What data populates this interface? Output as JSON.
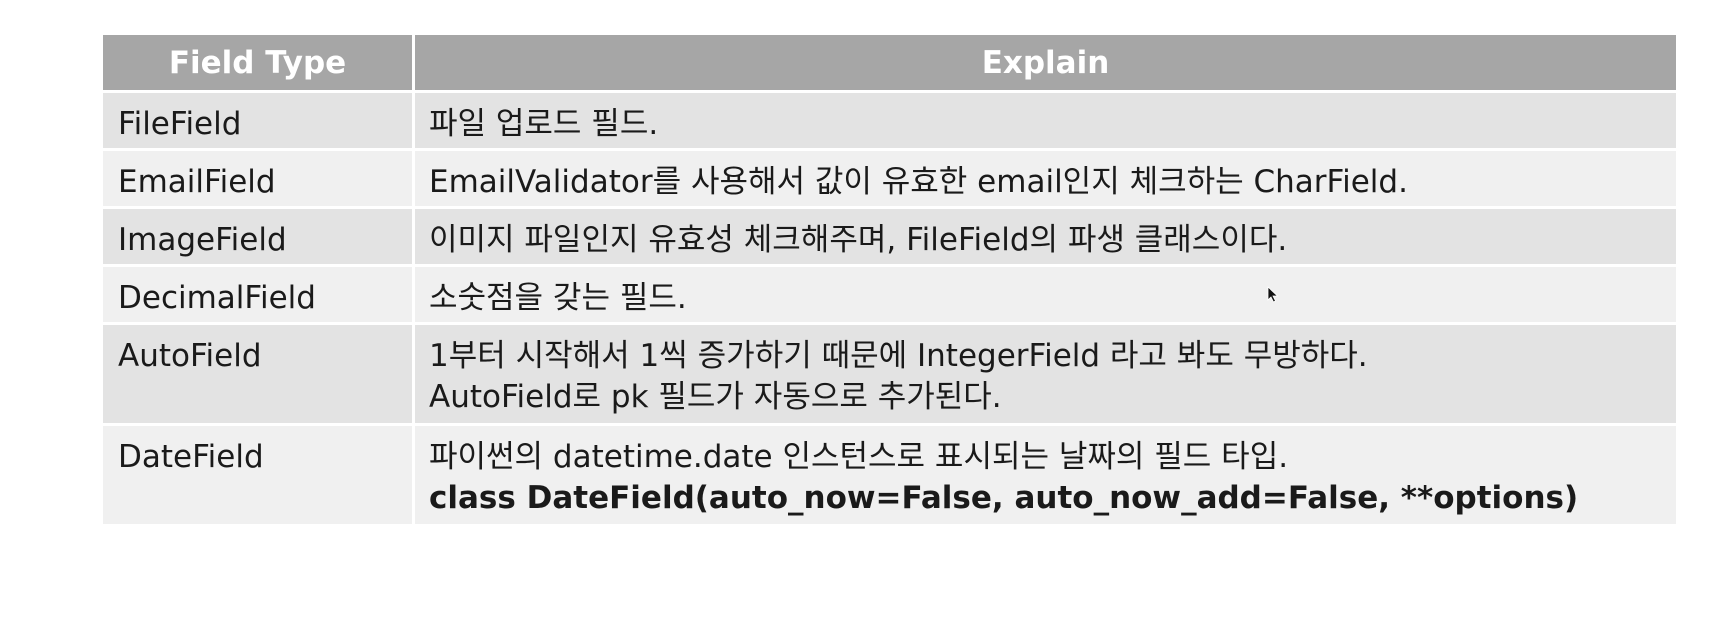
{
  "table": {
    "headers": [
      "Field Type",
      "Explain"
    ],
    "rows": [
      {
        "type": "FileField",
        "explain": [
          "파일 업로드 필드."
        ]
      },
      {
        "type": "EmailField",
        "explain": [
          "EmailValidator를 사용해서 값이 유효한 email인지 체크하는 CharField."
        ]
      },
      {
        "type": "ImageField",
        "explain": [
          "이미지 파일인지 유효성 체크해주며, FileField의 파생 클래스이다."
        ]
      },
      {
        "type": "DecimalField",
        "explain": [
          "소숫점을 갖는 필드."
        ]
      },
      {
        "type": "AutoField",
        "explain": [
          "1부터 시작해서 1씩 증가하기 때문에 IntegerField 라고 봐도 무방하다.",
          "AutoField로 pk 필드가 자동으로 추가된다."
        ]
      },
      {
        "type": "DateField",
        "explain": [
          "파이썬의 datetime.date 인스턴스로 표시되는 날짜의 필드 타입.",
          "class DateField(auto_now=False, auto_now_add=False, **options)"
        ]
      }
    ]
  },
  "colors": {
    "header_bg": "#a6a6a6",
    "row_dark": "#e3e3e3",
    "row_light": "#f0f0f0"
  },
  "cursor": {
    "icon": "mouse-pointer-icon"
  }
}
